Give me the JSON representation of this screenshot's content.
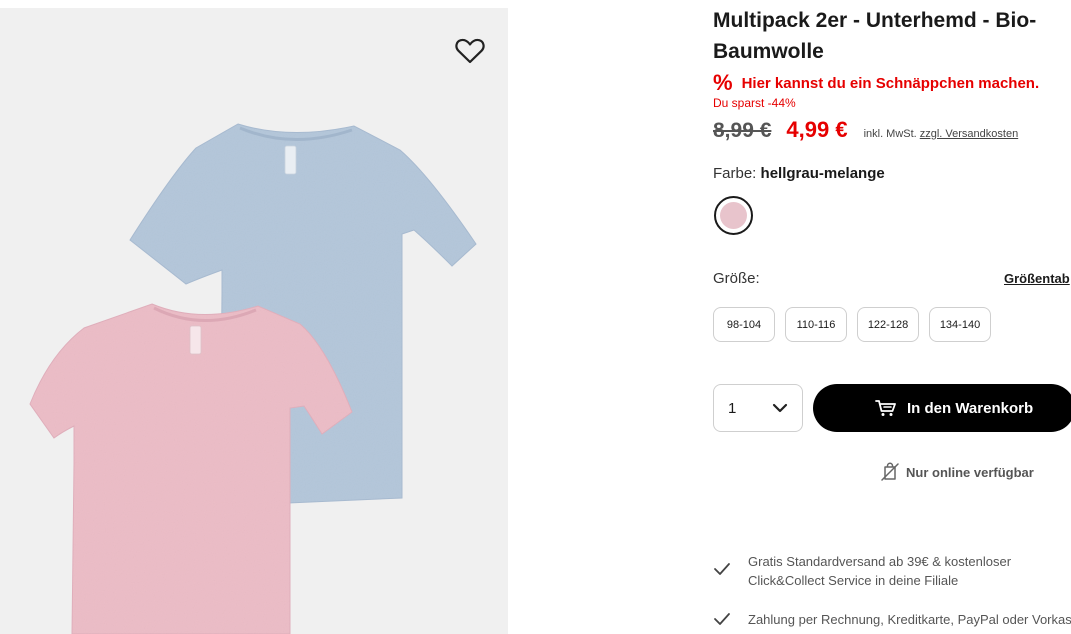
{
  "product": {
    "title": "Multipack 2er - Unterhemd - Bio-Baumwolle",
    "wishlist_icon": "heart-outline-icon"
  },
  "promo": {
    "icon": "%",
    "deal_text": "Hier kannst du ein Schnäppchen machen.",
    "savings_text": "Du sparst -44%"
  },
  "price": {
    "old": "8,99 €",
    "new": "4,99 €",
    "tax_note": "inkl. MwSt.",
    "shipping_link": "zzgl. Versandkosten"
  },
  "color": {
    "label": "Farbe:",
    "value": "hellgrau-melange",
    "swatch_color": "#e8c4cc"
  },
  "size": {
    "label": "Größe:",
    "table_link": "Größentab",
    "options": [
      "98-104",
      "110-116",
      "122-128",
      "134-140"
    ]
  },
  "cart": {
    "quantity": "1",
    "add_label": "In den Warenkorb"
  },
  "availability": {
    "text": "Nur online verfügbar"
  },
  "benefits": [
    {
      "line1": "Gratis Standardversand ab 39€ & kostenloser",
      "line2": "Click&Collect Service in deine Filiale"
    },
    {
      "line1": "Zahlung per Rechnung, Kreditkarte, PayPal oder Vorkass",
      "line2": ""
    }
  ],
  "colors": {
    "accent_red": "#e60000",
    "button_black": "#000000",
    "shirt_blue": "#b3c6da",
    "shirt_pink": "#ecbcc6",
    "image_bg": "#f0f0f0"
  }
}
